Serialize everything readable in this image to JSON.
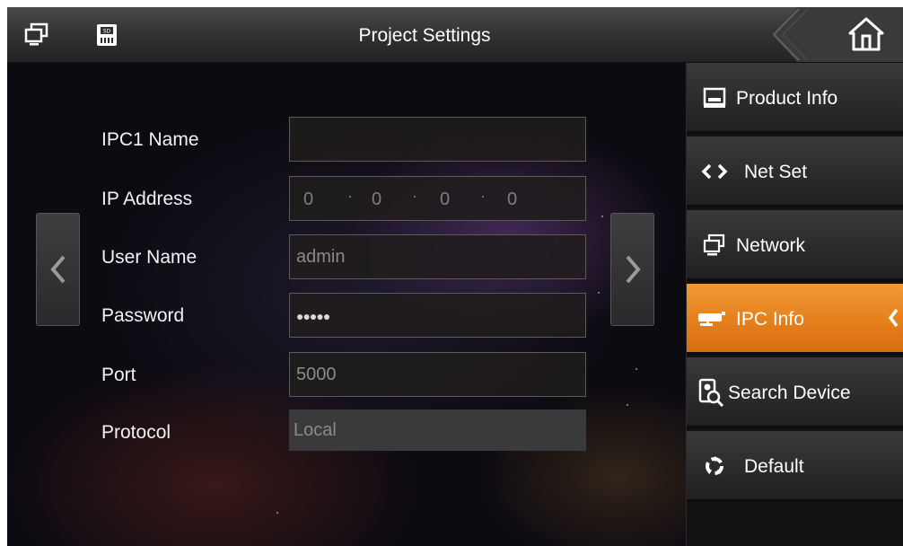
{
  "header": {
    "title": "Project Settings",
    "left_icons": [
      "monitor-icon",
      "sd-card-icon"
    ],
    "home_icon": "home-icon"
  },
  "form": {
    "fields": [
      {
        "label": "IPC1 Name",
        "value": ""
      },
      {
        "label": "IP Address",
        "octets": [
          "0",
          "0",
          "0",
          "0"
        ]
      },
      {
        "label": "User Name",
        "value": "admin"
      },
      {
        "label": "Password",
        "value": "●●●●●"
      },
      {
        "label": "Port",
        "value": "5000"
      },
      {
        "label": "Protocol",
        "value": "Local"
      }
    ]
  },
  "sidebar": {
    "items": [
      {
        "label": "Product Info",
        "icon": "product-info-icon"
      },
      {
        "label": "Net Set",
        "icon": "net-set-icon"
      },
      {
        "label": "Network",
        "icon": "network-icon"
      },
      {
        "label": "IPC Info",
        "icon": "camera-icon",
        "active": true
      },
      {
        "label": "Search Device",
        "icon": "search-device-icon"
      },
      {
        "label": "Default",
        "icon": "recycle-icon"
      }
    ]
  },
  "colors": {
    "accent": "#e5801a",
    "header_bg": "#333336",
    "sidebar_bg": "#2a2a2c"
  }
}
